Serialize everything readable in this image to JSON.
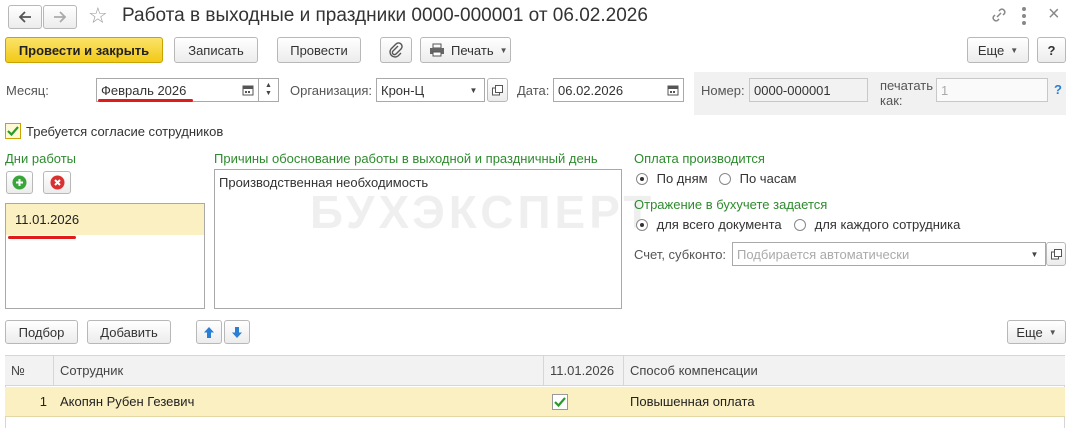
{
  "window": {
    "title": "Работа в выходные и праздники 0000-000001 от 06.02.2026"
  },
  "toolbar": {
    "post_close": "Провести и закрыть",
    "save": "Записать",
    "post": "Провести",
    "print": "Печать",
    "more": "Еще",
    "help": "?"
  },
  "fields": {
    "month_label": "Месяц:",
    "month_value": "Февраль 2026",
    "org_label": "Организация:",
    "org_value": "Крон-Ц",
    "date_label": "Дата:",
    "date_value": "06.02.2026",
    "number_label": "Номер:",
    "number_value": "0000-000001",
    "print_as_label": "печатать как:",
    "print_as_value": "1",
    "print_as_help": "?"
  },
  "consent": {
    "label": "Требуется согласие сотрудников",
    "checked": true
  },
  "work_days": {
    "title": "Дни работы",
    "items": [
      "11.01.2026"
    ]
  },
  "reasons": {
    "title": "Причины обоснование работы в выходной и праздничный день",
    "text": "Производственная необходимость"
  },
  "payment": {
    "title": "Оплата производится",
    "options": [
      "По дням",
      "По часам"
    ],
    "selected": 0
  },
  "accounting": {
    "title": "Отражение в бухучете задается",
    "options": [
      "для всего документа",
      "для каждого сотрудника"
    ],
    "selected": 0,
    "account_label": "Счет, субконто:",
    "account_placeholder": "Подбирается автоматически"
  },
  "table_toolbar": {
    "select": "Подбор",
    "add": "Добавить",
    "more": "Еще"
  },
  "table": {
    "columns": [
      "№",
      "Сотрудник",
      "11.01.2026",
      "Способ компенсации"
    ],
    "rows": [
      {
        "n": "1",
        "employee": "Акопян Рубен Гезевич",
        "checked": true,
        "compensation": "Повышенная оплата"
      }
    ]
  },
  "watermark": "БУХЭКСПЕРТ",
  "colors": {
    "accent_yellow": "#f5cf1f",
    "selection": "#fbf0c2",
    "group_title": "#2e8b2e",
    "highlight_underline": "#e01b1b"
  }
}
